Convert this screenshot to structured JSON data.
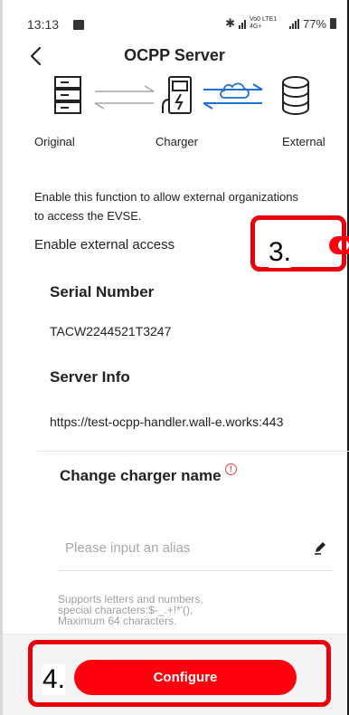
{
  "status_bar": {
    "time": "13:13",
    "network_text": "Vo0 LTE1 4G+",
    "battery": "77%"
  },
  "header": {
    "title": "OCPP Server",
    "back_icon": "chevron-left-icon"
  },
  "diagram": {
    "labels": {
      "original": "Original",
      "charger": "Charger",
      "external": "External"
    },
    "icons": [
      "server-icon",
      "charger-icon",
      "cloud-icon",
      "database-icon"
    ],
    "active_color": "#1f6fd6",
    "inactive_color": "#a6a6a6"
  },
  "description": "Enable this function to allow external organizations to access the EVSE.",
  "external_access": {
    "label": "Enable external access",
    "enabled": true,
    "toggle_color": "#ff000f"
  },
  "serial_number": {
    "title": "Serial Number",
    "value": "TACW2244521T3247"
  },
  "server_info": {
    "title": "Server Info",
    "value": "https://test-ocpp-handler.wall-e.works:443"
  },
  "charger_name": {
    "title": "Change charger name",
    "info_icon": "info-icon",
    "input_value": "",
    "placeholder": "Please input an alias",
    "edit_icon": "pencil-icon",
    "hint": "Supports letters and numbers,\nspecial characters:$-_.+!*'(),\nMaximum 64 characters."
  },
  "footer": {
    "configure_label": "Configure",
    "button_color": "#ff000f"
  },
  "annotations": {
    "step3": "3.",
    "step4": "4.",
    "color": "#e8000b"
  }
}
